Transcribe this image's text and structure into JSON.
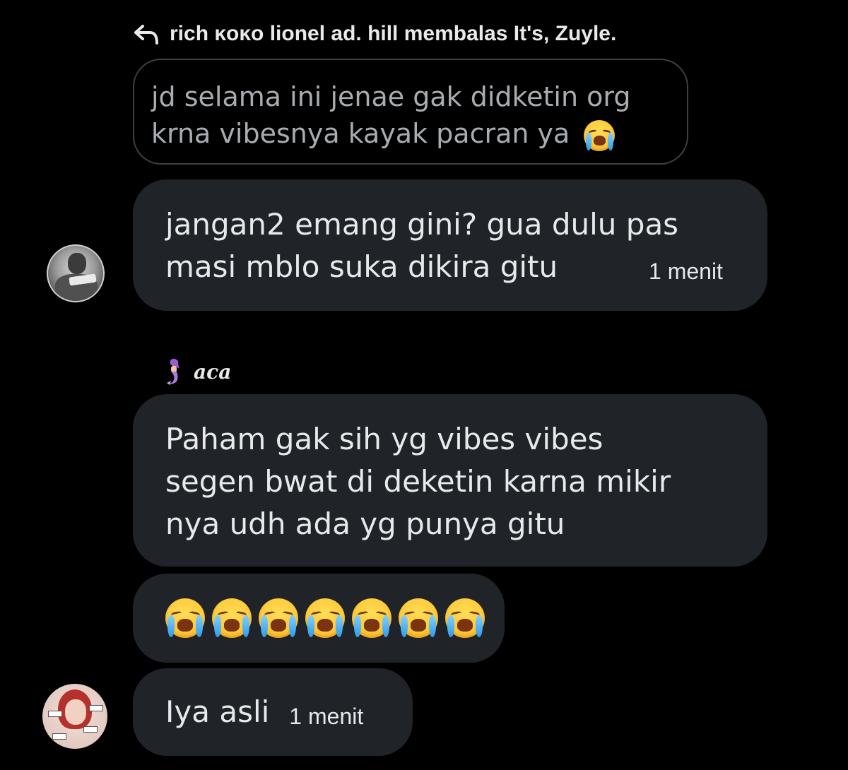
{
  "reply_header": {
    "icon": "reply-arrow-icon",
    "text": "rich ĸoĸo lionel ad. hill membalas It's, Zuyle."
  },
  "quoted_message": {
    "lines": [
      "jd selama ini jenae gak didketin org",
      "krna vibesnya kayak pacran ya"
    ],
    "emoji": "loudly-crying-face-icon"
  },
  "messages": [
    {
      "lines": [
        "jangan2 emang gini? gua dulu pas",
        "masi mblo suka dikira gitu"
      ],
      "time": "1 menit",
      "avatar": "lionel-avatar"
    },
    {
      "sender": {
        "name": "aca",
        "icon": "mermaid-icon"
      },
      "lines": [
        "Paham gak sih yg vibes vibes",
        "segen bwat di deketin karna mikir",
        "nya udh ada yg punya gitu"
      ]
    },
    {
      "emoji_count": 7,
      "emoji": "loudly-crying-face-icon"
    },
    {
      "text": "Iya asli",
      "time": "1 menit",
      "avatar": "zuyle-avatar"
    }
  ],
  "colors": {
    "background": "#000000",
    "bubble": "#202327",
    "quote_border": "#3e4144",
    "text": "#e7e9ea",
    "quote_text": "#a9adb1"
  }
}
